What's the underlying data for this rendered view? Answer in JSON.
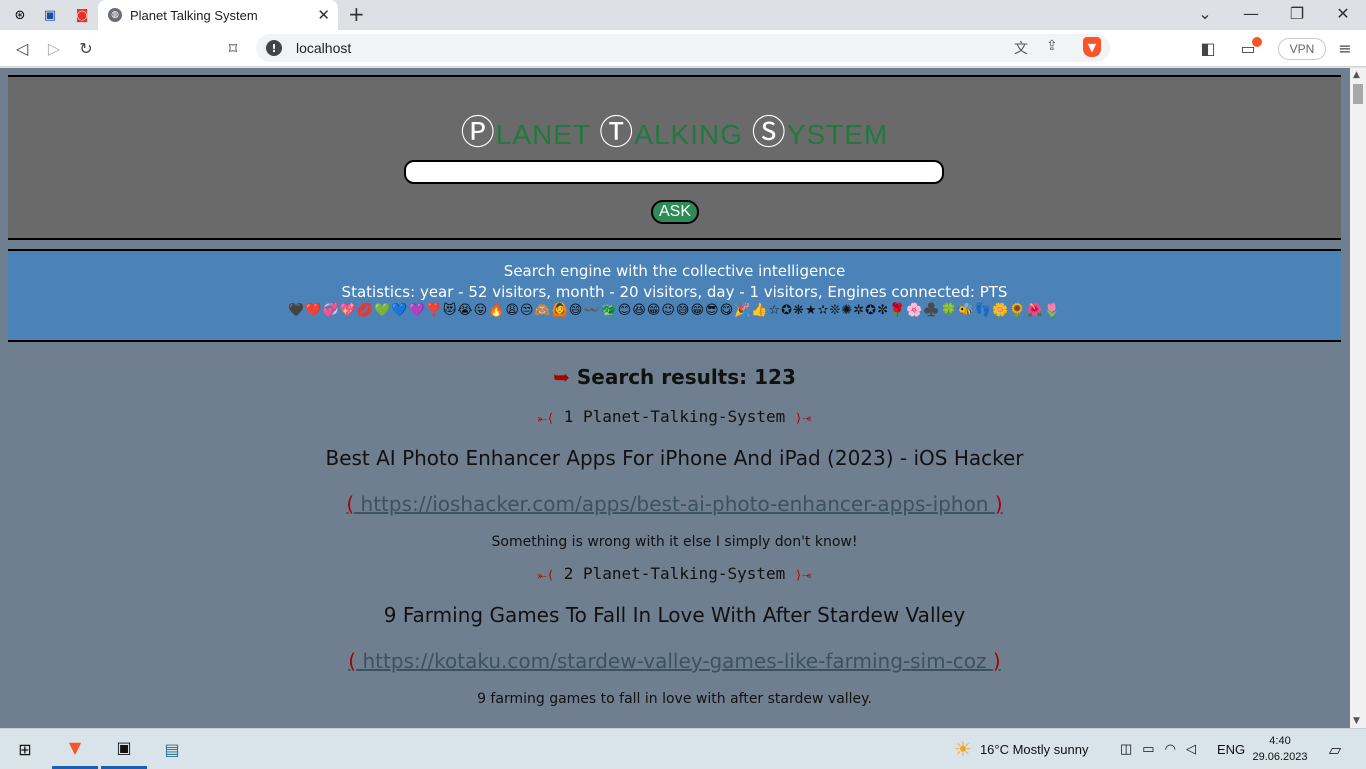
{
  "browser": {
    "tab_title": "Planet Talking System",
    "url": "localhost",
    "vpn_label": "VPN"
  },
  "header": {
    "logo": [
      {
        "cap": "Ⓟ",
        "rest": "LANET"
      },
      {
        "cap": "Ⓣ",
        "rest": "ALKING"
      },
      {
        "cap": "Ⓢ",
        "rest": "YSTEM"
      }
    ],
    "search_value": "",
    "ask_label": "ASK"
  },
  "info": {
    "tagline": "Search engine with the collective intelligence",
    "stats": "Statistics: year - 52 visitors, month - 20 visitors, day - 1 visitors, Engines connected: PTS",
    "emoji_row": "🖤❤️💞💖💋💚💙💜❣️😻😭😛🔥😩😒🙈🙆😄〰️🐲😊😆😁😉😅😁😎😋🎉👍☆✪❋★✫❊✺✲✪✼🌹🌸♣️🍀🐝👣🌼🌻🌺🌷"
  },
  "results": {
    "count_label": "Search results: 123",
    "items": [
      {
        "label": "1 Planet-Talking-System",
        "title": "Best AI Photo Enhancer Apps For iPhone And iPad (2023) - iOS Hacker",
        "url": "https://ioshacker.com/apps/best-ai-photo-enhancer-apps-iphon",
        "desc": "Something is wrong with it else I simply don't know!"
      },
      {
        "label": "2 Planet-Talking-System",
        "title": "9 Farming Games To Fall In Love With After Stardew Valley",
        "url": "https://kotaku.com/stardew-valley-games-like-farming-sim-coz",
        "desc": "9 farming games to fall in love with after stardew valley."
      }
    ]
  },
  "taskbar": {
    "weather": "16°C  Mostly sunny",
    "language": "ENG",
    "time": "4:40",
    "date": "29.06.2023"
  }
}
